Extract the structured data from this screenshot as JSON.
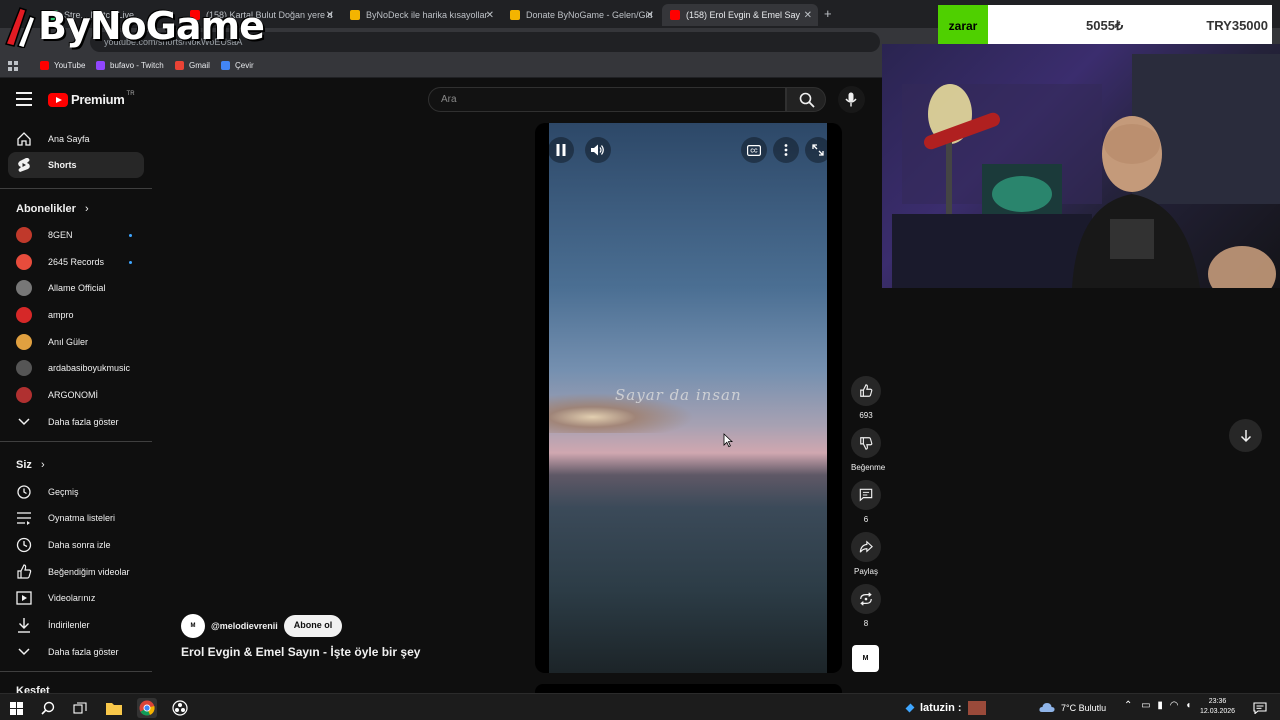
{
  "browser": {
    "tabs": [
      {
        "label": "Stre... Match Live"
      },
      {
        "label": "(158) Kartal Bulut Doğan yere d"
      },
      {
        "label": "ByNoDeck ile harika kısayollar"
      },
      {
        "label": "Donate ByNoGame - Gelen/Gid"
      },
      {
        "label": "(158) Erol Evgin & Emel Say"
      }
    ],
    "new_tab_icon": "plus-icon",
    "url": "youtube.com/shorts/NokWoEUsaA",
    "bookmarks": [
      {
        "label": "YouTube",
        "color": "#ff0000"
      },
      {
        "label": "bufavo - Twitch",
        "color": "#9146ff"
      },
      {
        "label": "Gmail",
        "color": "#ea4335"
      },
      {
        "label": "Çevir",
        "color": "#4285f4"
      }
    ]
  },
  "overlay": {
    "logo_text": "ByNoGame"
  },
  "youtube": {
    "brand": "Premium",
    "country": "TR",
    "search_placeholder": "Ara"
  },
  "sidebar": {
    "main": [
      {
        "label": "Ana Sayfa",
        "icon": "home-icon"
      },
      {
        "label": "Shorts",
        "icon": "shorts-icon"
      }
    ],
    "subscriptions_title": "Abonelikler",
    "subscriptions": [
      {
        "label": "8GEN",
        "color": "#c0392b",
        "dot": true
      },
      {
        "label": "2645 Records",
        "color": "#e74c3c",
        "dot": true
      },
      {
        "label": "Allame Official",
        "color": "#777777",
        "dot": false
      },
      {
        "label": "ampro",
        "color": "#d62828",
        "dot": false
      },
      {
        "label": "Anıl Güler",
        "color": "#e0a040",
        "dot": false
      },
      {
        "label": "ardabasiboyukmusic",
        "color": "#555555",
        "dot": false
      },
      {
        "label": "ARGONOMİ",
        "color": "#b03030",
        "dot": false
      }
    ],
    "show_more_subs": "Daha fazla göster",
    "you_title": "Siz",
    "you": [
      {
        "label": "Geçmiş",
        "icon": "history-icon"
      },
      {
        "label": "Oynatma listeleri",
        "icon": "playlist-icon"
      },
      {
        "label": "Daha sonra izle",
        "icon": "clock-icon"
      },
      {
        "label": "Beğendiğim videolar",
        "icon": "thumbs-up-icon"
      },
      {
        "label": "Videolarınız",
        "icon": "video-icon"
      },
      {
        "label": "İndirilenler",
        "icon": "download-icon"
      }
    ],
    "show_more_you": "Daha fazla göster",
    "explore_title": "Keşfet"
  },
  "short": {
    "caption": "Sayar da insan",
    "channel_avatar_text": "M",
    "channel": "@melodievrenii",
    "subscribe": "Abone ol",
    "title": "Erol Evgin & Emel Sayın - İşte öyle bir şey",
    "actions": {
      "like_count": "693",
      "dislike_label": "Beğenme",
      "comment_count": "6",
      "share_label": "Paylaş",
      "remix_count": "8"
    }
  },
  "donation": {
    "tag": "zarar",
    "amount": "5055₺",
    "goal": "TRY35000"
  },
  "taskbar": {
    "tray_user": "latuzin :",
    "weather": "7°C  Bulutlu",
    "time": "23:36",
    "date": "12.03.2026"
  }
}
